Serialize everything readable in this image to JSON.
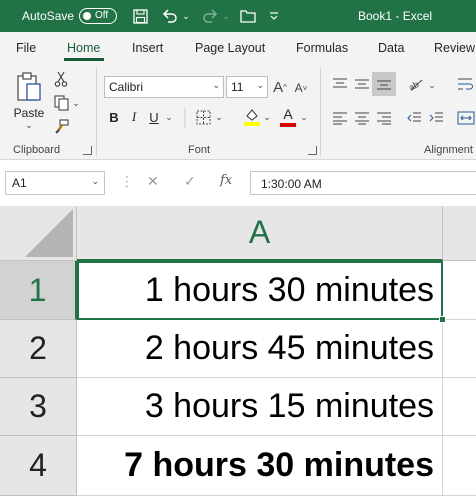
{
  "titlebar": {
    "autosave_label": "AutoSave",
    "autosave_state": "Off",
    "document_title": "Book1  -  Excel",
    "icons": [
      "save-icon",
      "undo-icon",
      "redo-icon",
      "folder-icon",
      "customize-qat-icon"
    ]
  },
  "ribbon": {
    "tabs": [
      "File",
      "Home",
      "Insert",
      "Page Layout",
      "Formulas",
      "Data",
      "Review"
    ],
    "active_tab": "Home",
    "clipboard": {
      "paste_label": "Paste",
      "group_label": "Clipboard"
    },
    "font": {
      "family": "Calibri",
      "size": "11",
      "group_label": "Font",
      "bold": "B",
      "italic": "I",
      "underline": "U",
      "font_color_letter": "A",
      "grow_font": "A^",
      "shrink_font": "A˅"
    },
    "alignment": {
      "group_label": "Alignment"
    }
  },
  "formula_bar": {
    "name_box": "A1",
    "fx_label": "fx",
    "content": "1:30:00 AM"
  },
  "sheet": {
    "columns": [
      "A"
    ],
    "rows": [
      {
        "header": "1",
        "value": "1 hours 30 minutes",
        "bold": false
      },
      {
        "header": "2",
        "value": "2 hours 45 minutes",
        "bold": false
      },
      {
        "header": "3",
        "value": "3 hours 15 minutes",
        "bold": false
      },
      {
        "header": "4",
        "value": "7 hours 30 minutes",
        "bold": true
      }
    ],
    "selected_cell": "A1"
  },
  "colors": {
    "excel_green": "#217346",
    "ribbon_bg": "#f3f3f3",
    "header_bg": "#e6e6e6",
    "highlight_yellow": "#ffff00",
    "font_red": "#e00000"
  }
}
